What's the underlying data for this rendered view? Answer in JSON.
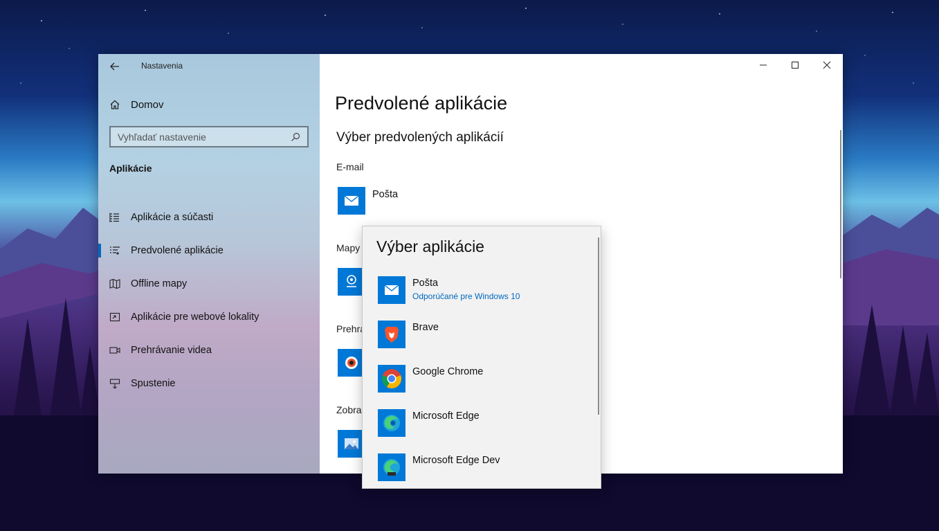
{
  "window": {
    "title": "Nastavenia"
  },
  "sidebar": {
    "home_label": "Domov",
    "search_placeholder": "Vyhľadať nastavenie",
    "section_title": "Aplikácie",
    "items": [
      {
        "label": "Aplikácie a súčasti",
        "icon": "apps-list-icon",
        "active": false
      },
      {
        "label": "Predvolené aplikácie",
        "icon": "default-apps-icon",
        "active": true
      },
      {
        "label": "Offline mapy",
        "icon": "map-icon",
        "active": false
      },
      {
        "label": "Aplikácie pre webové lokality",
        "icon": "web-apps-icon",
        "active": false
      },
      {
        "label": "Prehrávanie videa",
        "icon": "video-icon",
        "active": false
      },
      {
        "label": "Spustenie",
        "icon": "startup-icon",
        "active": false
      }
    ]
  },
  "main": {
    "page_title": "Predvolené aplikácie",
    "subtitle": "Výber predvolených aplikácií",
    "sections": [
      {
        "label": "E-mail",
        "app": "Pošta"
      },
      {
        "label": "Mapy",
        "app": ""
      },
      {
        "label": "Prehra",
        "app": ""
      },
      {
        "label": "Zobra",
        "app": ""
      }
    ]
  },
  "picker": {
    "title": "Výber aplikácie",
    "items": [
      {
        "name": "Pošta",
        "subtitle": "Odporúčané pre Windows 10",
        "icon": "mail-icon"
      },
      {
        "name": "Brave",
        "subtitle": "",
        "icon": "brave-icon"
      },
      {
        "name": "Google Chrome",
        "subtitle": "",
        "icon": "chrome-icon"
      },
      {
        "name": "Microsoft Edge",
        "subtitle": "",
        "icon": "edge-icon"
      },
      {
        "name": "Microsoft Edge Dev",
        "subtitle": "",
        "icon": "edge-dev-icon"
      }
    ]
  },
  "colors": {
    "accent": "#0067c0",
    "tile_blue": "#0078d7"
  }
}
